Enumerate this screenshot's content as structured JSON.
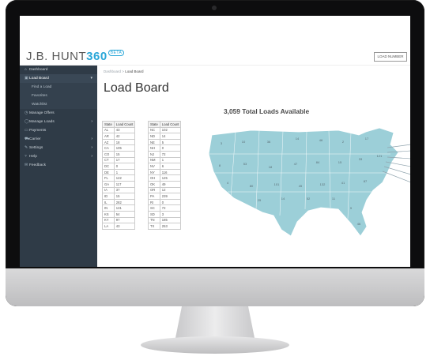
{
  "app": {
    "logo_text": "J.B. HUNT",
    "logo_num": "360",
    "logo_badge": "BETA",
    "load_number_label": "LOAD NUMBER"
  },
  "sidebar": {
    "items": [
      {
        "label": "Dashboard",
        "icon": "home-icon"
      },
      {
        "label": "Load Board",
        "icon": "board-icon"
      },
      {
        "label": "Find a Load"
      },
      {
        "label": "Favorites"
      },
      {
        "label": "Watchlist"
      },
      {
        "label": "Manage Offers",
        "icon": "offers-icon"
      },
      {
        "label": "Manage Loads",
        "icon": "loads-icon"
      },
      {
        "label": "Payments",
        "icon": "payments-icon"
      },
      {
        "label": "Carrier",
        "icon": "carrier-icon"
      },
      {
        "label": "Settings",
        "icon": "settings-icon"
      },
      {
        "label": "Help",
        "icon": "help-icon"
      },
      {
        "label": "Feedback",
        "icon": "feedback-icon"
      }
    ]
  },
  "breadcrumb": {
    "root": "Dashboard",
    "sep": ">",
    "current": "Load Board"
  },
  "page": {
    "title": "Load Board",
    "total_loads": "3,059 Total Loads Available"
  },
  "table_left": {
    "headers": [
      "State",
      "Load Count"
    ],
    "rows": [
      [
        "AL",
        "43"
      ],
      [
        "AR",
        "42"
      ],
      [
        "AZ",
        "18"
      ],
      [
        "CA",
        "105"
      ],
      [
        "CO",
        "15"
      ],
      [
        "CT",
        "17"
      ],
      [
        "DC",
        "0"
      ],
      [
        "DE",
        "1"
      ],
      [
        "FL",
        "122"
      ],
      [
        "GA",
        "117"
      ],
      [
        "IA",
        "37"
      ],
      [
        "ID",
        "15"
      ],
      [
        "IL",
        "282"
      ],
      [
        "IN",
        "131"
      ],
      [
        "KS",
        "54"
      ],
      [
        "KY",
        "97"
      ],
      [
        "LA",
        "43"
      ]
    ]
  },
  "table_right": {
    "headers": [
      "State",
      "Load Count"
    ],
    "rows": [
      [
        "NC",
        "102"
      ],
      [
        "ND",
        "14"
      ],
      [
        "NE",
        "5"
      ],
      [
        "NH",
        "0"
      ],
      [
        "NJ",
        "72"
      ],
      [
        "NM",
        "1"
      ],
      [
        "NV",
        "6"
      ],
      [
        "NY",
        "116"
      ],
      [
        "OH",
        "125"
      ],
      [
        "OK",
        "49"
      ],
      [
        "OR",
        "12"
      ],
      [
        "PA",
        "239"
      ],
      [
        "RI",
        "0"
      ],
      [
        "SC",
        "72"
      ],
      [
        "SD",
        "3"
      ],
      [
        "TN",
        "185"
      ],
      [
        "TX",
        "253"
      ]
    ]
  },
  "map": {
    "fill_color": "#9ccfd8",
    "labels": [
      "3",
      "10",
      "36",
      "14",
      "46",
      "2",
      "17",
      "8",
      "53",
      "18",
      "47",
      "84",
      "15",
      "33",
      "121",
      "4",
      "80",
      "101",
      "45",
      "132",
      "41",
      "87",
      "25",
      "14",
      "52",
      "11",
      "9",
      "46"
    ]
  },
  "colors": {
    "sidebar": "#2f3b47",
    "accent": "#2aa7d8"
  }
}
